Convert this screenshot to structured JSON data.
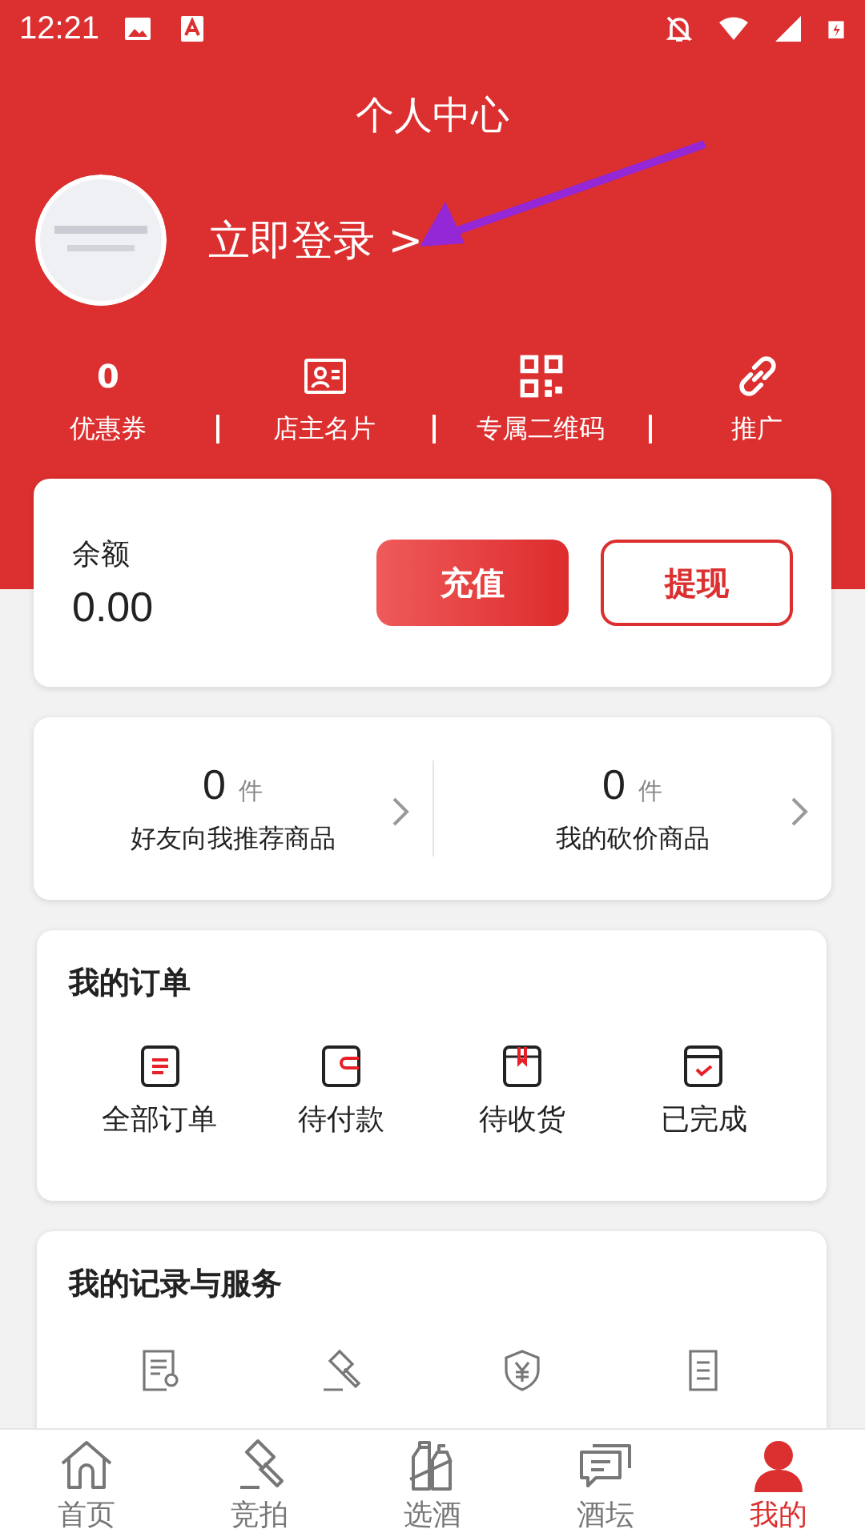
{
  "status_bar": {
    "time": "12:21"
  },
  "header": {
    "title": "个人中心",
    "login": "立即登录 >"
  },
  "annotation": {
    "kind": "arrow"
  },
  "shortcuts": [
    {
      "kind": "count",
      "value": "0",
      "label": "优惠券"
    },
    {
      "kind": "card",
      "label": "店主名片"
    },
    {
      "kind": "qrcode",
      "label": "专属二维码"
    },
    {
      "kind": "link",
      "label": "推广"
    }
  ],
  "balance": {
    "label": "余额",
    "amount": "0.00",
    "buttons": [
      {
        "label": "充值",
        "kind": "primary"
      },
      {
        "label": "提现",
        "kind": "outline"
      }
    ]
  },
  "counters": [
    {
      "value": "0",
      "unit": "件",
      "label": "好友向我推荐商品"
    },
    {
      "value": "0",
      "unit": "件",
      "label": "我的砍价商品"
    }
  ],
  "orders": {
    "title": "我的订单",
    "items": [
      {
        "kind": "all",
        "label": "全部订单"
      },
      {
        "kind": "pay",
        "label": "待付款"
      },
      {
        "kind": "receive",
        "label": "待收货"
      },
      {
        "kind": "done",
        "label": "已完成"
      }
    ]
  },
  "services": {
    "title": "我的记录与服务",
    "items": [
      {
        "kind": "certificate"
      },
      {
        "kind": "auction"
      },
      {
        "kind": "shield"
      },
      {
        "kind": "list"
      }
    ]
  },
  "tab_bar": [
    {
      "kind": "home",
      "label": "首页",
      "selected": false
    },
    {
      "kind": "auction",
      "label": "竞拍",
      "selected": false
    },
    {
      "kind": "bottles",
      "label": "选酒",
      "selected": false
    },
    {
      "kind": "chat",
      "label": "酒坛",
      "selected": false
    },
    {
      "kind": "person",
      "label": "我的",
      "selected": true
    }
  ]
}
